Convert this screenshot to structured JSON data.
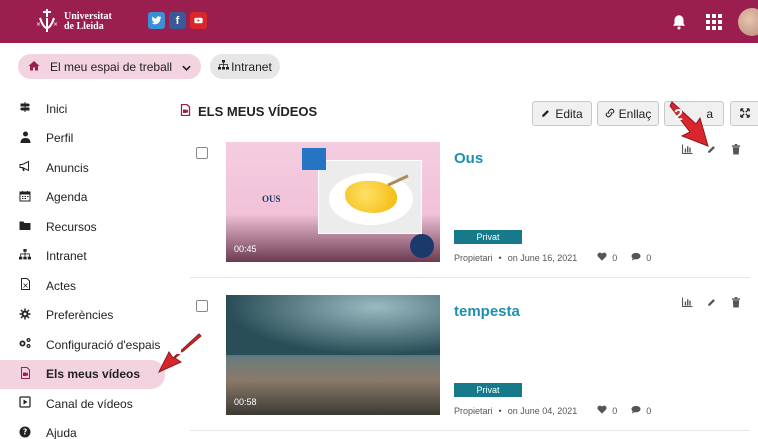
{
  "topbar": {
    "logo_line1": "Universitat",
    "logo_line2": "de Lleida",
    "social": [
      "twitter-icon",
      "facebook-icon",
      "youtube-icon"
    ],
    "brand_color": "#9b1f4e"
  },
  "breadcrumb": {
    "main_label": "El meu espai de treball",
    "intranet_label": "Intranet"
  },
  "sidebar": {
    "items": [
      {
        "label": "Inici",
        "icon": "signpost-icon"
      },
      {
        "label": "Perfil",
        "icon": "user-icon"
      },
      {
        "label": "Anuncis",
        "icon": "megaphone-icon"
      },
      {
        "label": "Agenda",
        "icon": "calendar-icon"
      },
      {
        "label": "Recursos",
        "icon": "folder-icon"
      },
      {
        "label": "Intranet",
        "icon": "sitemap-icon"
      },
      {
        "label": "Actes",
        "icon": "file-icon"
      },
      {
        "label": "Preferències",
        "icon": "gear-icon"
      },
      {
        "label": "Configuració d'espais",
        "icon": "gears-icon"
      },
      {
        "label": "Els meus vídeos",
        "icon": "video-file-icon"
      },
      {
        "label": "Canal de vídeos",
        "icon": "play-square-icon"
      },
      {
        "label": "Ajuda",
        "icon": "question-icon"
      }
    ],
    "active_index": 9
  },
  "main": {
    "title": "ELS MEUS VÍDEOS",
    "toolbar": {
      "edit_label": "Edita",
      "link_label": "Enllaç",
      "third_label": "a"
    }
  },
  "videos": [
    {
      "title": "Ous",
      "thumb_caption": "OUS",
      "duration": "00:45",
      "badge": "Privat",
      "owner": "Propietari",
      "date": "on June 16, 2021",
      "likes": "0",
      "comments": "0"
    },
    {
      "title": "tempesta",
      "thumb_caption": "",
      "duration": "00:58",
      "badge": "Privat",
      "owner": "Propietari",
      "date": "on June 04, 2021",
      "likes": "0",
      "comments": "0"
    }
  ],
  "callouts": {
    "first": "1",
    "second": "2",
    "color": "#d9262c"
  }
}
